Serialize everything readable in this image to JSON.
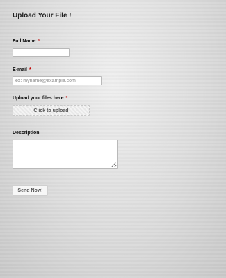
{
  "form": {
    "title": "Upload Your File !",
    "required_marker": "*",
    "full_name": {
      "label": "Full Name",
      "value": "",
      "placeholder": ""
    },
    "email": {
      "label": "E-mail",
      "value": "",
      "placeholder": "ex: myname@example.com"
    },
    "upload": {
      "label": "Upload your files here",
      "button_label": "Click to upload"
    },
    "description": {
      "label": "Description",
      "value": ""
    },
    "submit_label": "Send Now!"
  }
}
